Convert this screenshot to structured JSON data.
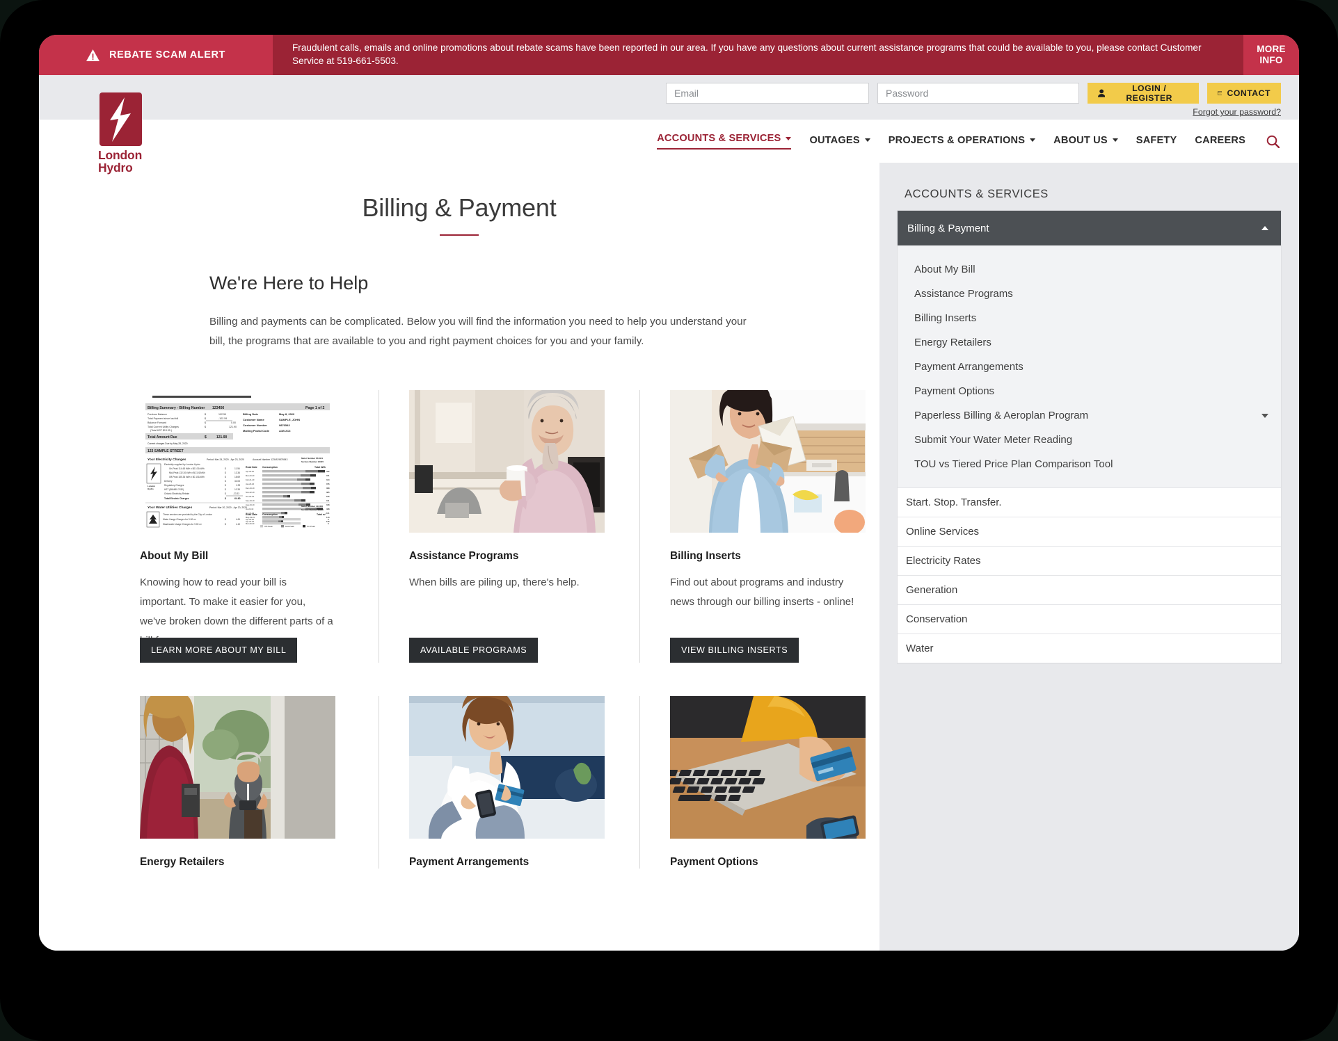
{
  "alert": {
    "tag_label": "REBATE SCAM ALERT",
    "warning_icon": "warning-triangle-icon",
    "message": "Fraudulent calls, emails and online promotions about rebate scams have been reported in our area. If you have any questions about current assistance programs that could be available to you, please contact Customer Service at 519-661-5503.",
    "more_info": "MORE\nINFO",
    "more_info_line1": "MORE",
    "more_info_line2": "INFO",
    "bg_dark": "#9b2335",
    "bg_light": "#c4324a"
  },
  "login": {
    "email_placeholder": "Email",
    "email_value": "",
    "password_placeholder": "Password",
    "password_value": "",
    "login_label": "LOGIN / REGISTER",
    "login_icon": "user-icon",
    "contact_label": "CONTACT",
    "contact_icon": "envelope-icon",
    "forgot_label": "Forgot your password?",
    "button_color": "#f2cb4a"
  },
  "brand": {
    "logo_icon": "lightning-bolt-icon",
    "name_line1": "London",
    "name_line2": "Hydro",
    "color": "#9b2335"
  },
  "nav": {
    "items": [
      {
        "label": "ACCOUNTS & SERVICES",
        "has_caret": true,
        "active": true
      },
      {
        "label": "OUTAGES",
        "has_caret": true,
        "active": false
      },
      {
        "label": "PROJECTS & OPERATIONS",
        "has_caret": true,
        "active": false
      },
      {
        "label": "ABOUT US",
        "has_caret": true,
        "active": false
      },
      {
        "label": "SAFETY",
        "has_caret": false,
        "active": false
      },
      {
        "label": "CAREERS",
        "has_caret": false,
        "active": false
      }
    ],
    "search_icon": "search-icon"
  },
  "main": {
    "page_title": "Billing & Payment",
    "section_heading": "We're Here to Help",
    "intro": "Billing and payments can be complicated. Below you will find the information you need to help you understand your bill, the programs that are available to you and right payment choices for you and your family."
  },
  "cards_row1": [
    {
      "image_name": "hydro-bill-sample-image",
      "title": "About My Bill",
      "text": "Knowing how to read your bill is important. To make it easier for you, we've broken down the different parts of a bill for you.",
      "button": "LEARN MORE ABOUT MY BILL"
    },
    {
      "image_name": "senior-woman-with-mug-image",
      "title": "Assistance Programs",
      "text": "When bills are piling up, there's help.",
      "button": "AVAILABLE PROGRAMS"
    },
    {
      "image_name": "woman-opening-mail-image",
      "title": "Billing Inserts",
      "text": "Find out about programs and industry news through our billing inserts - online!",
      "button": "VIEW BILLING INSERTS"
    }
  ],
  "cards_row2": [
    {
      "image_name": "doorstep-salesperson-image",
      "title": "Energy Retailers",
      "text": "",
      "button": ""
    },
    {
      "image_name": "woman-with-phone-and-card-image",
      "title": "Payment Arrangements",
      "text": "",
      "button": ""
    },
    {
      "image_name": "laptop-credit-card-payment-image",
      "title": "Payment Options",
      "text": "",
      "button": ""
    }
  ],
  "bill_sample": {
    "header_left": "Billing Summary - Billing Number",
    "header_number": "123456",
    "header_right": "Page 1 of 2",
    "rows_left": [
      {
        "label": "Previous Balance",
        "cur": "$",
        "amt": "102.59"
      },
      {
        "label": "Total Payment since last bill",
        "cur": "$",
        "amt": "-102.59"
      },
      {
        "label": "Balance Forward",
        "cur": "$",
        "amt": "0.00"
      },
      {
        "label": "Total Current Utility Charges",
        "cur": "$",
        "amt": "121.90"
      },
      {
        "label": "(Total HST $13.35 )",
        "cur": "",
        "amt": ""
      }
    ],
    "total_label": "Total Amount Due",
    "total_cur": "$",
    "total_amt": "121.90",
    "due_note": "Current charges Due by May 28, 2020",
    "info_rows": [
      {
        "label": "Billing Date",
        "value": "May 8, 2020"
      },
      {
        "label": "Customer Name",
        "value": "SAMPLE, JOHN"
      },
      {
        "label": "Customer Number",
        "value": "9876543"
      },
      {
        "label": "Mailing Postal Code",
        "value": "A1B 2C3"
      }
    ],
    "address": "123 SAMPLE STREET",
    "elec_title": "Your Electricity Charges",
    "elec_period": "Period: Mar 24, 2020 - Apr 23, 2020",
    "elec_account": "Account Number 1234S-9876543",
    "elec_meter": "Meter Number 654321",
    "elec_service": "Service Number 12345",
    "elec_supply": "Electricity supplied by London Hydro",
    "elec_rows": [
      {
        "label": "On-Peak 114.48 kWh x $0.101/kWh",
        "cur": "$",
        "amt": "11.56"
      },
      {
        "label": "Mid-Peak 132.30 kWh x $0.101/kWh",
        "cur": "$",
        "amt": "13.36"
      },
      {
        "label": "Off-Peak 185.36 kWh x $0.101/kWh",
        "cur": "$",
        "amt": "18.69"
      },
      {
        "label": "Delivery",
        "cur": "$",
        "amt": "34.05"
      },
      {
        "label": "Regulatory Charges",
        "cur": "$",
        "amt": "1.99"
      },
      {
        "label": "HST (866480-7430)",
        "cur": "$",
        "amt": "10.35"
      },
      {
        "label": "Ontario Electricity Rebate",
        "cur": "$",
        "amt": "-23.33"
      },
      {
        "label": "Total Electric Charges",
        "cur": "$",
        "amt": "64.60"
      }
    ],
    "read_date_label": "Read Date",
    "consumption_label": "Consumption",
    "total_kwh_label": "Total kWh",
    "legend": [
      "Off-Peak",
      "Mid-Peak",
      "On-Peak"
    ],
    "history": [
      {
        "date": "Apr-23-20",
        "kwh": "432",
        "off": 62,
        "mid": 18,
        "on": 20
      },
      {
        "date": "Mar-23-20",
        "kwh": "371",
        "off": 55,
        "mid": 14,
        "on": 14
      },
      {
        "date": "Feb-21-20",
        "kwh": "344",
        "off": 50,
        "mid": 12,
        "on": 12
      },
      {
        "date": "Jan-23-20",
        "kwh": "376",
        "off": 56,
        "mid": 12,
        "on": 12
      },
      {
        "date": "Dec-23-19",
        "kwh": "398",
        "off": 58,
        "mid": 12,
        "on": 12
      },
      {
        "date": "Nov-22-19",
        "kwh": "385",
        "off": 56,
        "mid": 12,
        "on": 12
      },
      {
        "date": "Oct-23-19",
        "kwh": "185",
        "off": 30,
        "mid": 5,
        "on": 5
      },
      {
        "date": "Sep-23-19",
        "kwh": "311",
        "off": 46,
        "mid": 10,
        "on": 10
      },
      {
        "date": "Aug-23-19",
        "kwh": "348",
        "off": 52,
        "mid": 11,
        "on": 11
      },
      {
        "date": "Jul-23-19",
        "kwh": "428",
        "off": 62,
        "mid": 16,
        "on": 16
      },
      {
        "date": "Jun-21-19",
        "kwh": "161",
        "off": 27,
        "mid": 5,
        "on": 5
      },
      {
        "date": "May-23-19",
        "kwh": "143",
        "off": 24,
        "mid": 4,
        "on": 4
      },
      {
        "date": "Apr-23-19",
        "kwh": "136",
        "off": 23,
        "mid": 4,
        "on": 4
      }
    ],
    "water_title": "Your Water Utilities Charges",
    "water_period": "Period: Mar 20, 2020 - Apr 20, 2020",
    "water_meter": "Meter Number 123456",
    "water_service": "Service Number 12345",
    "water_note": "These services are provided by the City of London",
    "water_rows": [
      {
        "label": "Water Usage Charges for 9.00 m³",
        "cur": "$",
        "amt": "4.61"
      },
      {
        "label": "Wastewater Usage Charges for 9.00 m³",
        "cur": "$",
        "amt": "4.10"
      }
    ],
    "water_total_label": "Total m³",
    "water_history": [
      {
        "date": "Apr-20-20",
        "v": 55
      },
      {
        "date": "Mar-20-20",
        "v": 48
      }
    ]
  },
  "sidebar": {
    "heading": "ACCOUNTS & SERVICES",
    "accordion": {
      "label": "Billing & Payment",
      "expanded": true,
      "caret_icon": "chevron-up-icon"
    },
    "submenu": [
      {
        "label": "About My Bill",
        "caret": false
      },
      {
        "label": "Assistance Programs",
        "caret": false
      },
      {
        "label": "Billing Inserts",
        "caret": false
      },
      {
        "label": "Energy Retailers",
        "caret": false
      },
      {
        "label": "Payment Arrangements",
        "caret": false
      },
      {
        "label": "Payment Options",
        "caret": false
      },
      {
        "label": "Paperless Billing & Aeroplan Program",
        "caret": true
      },
      {
        "label": "Submit Your Water Meter Reading",
        "caret": false
      },
      {
        "label": "TOU vs Tiered Price Plan Comparison Tool",
        "caret": false
      }
    ],
    "links": [
      "Start. Stop. Transfer.",
      "Online Services",
      "Electricity Rates",
      "Generation",
      "Conservation",
      "Water"
    ]
  }
}
